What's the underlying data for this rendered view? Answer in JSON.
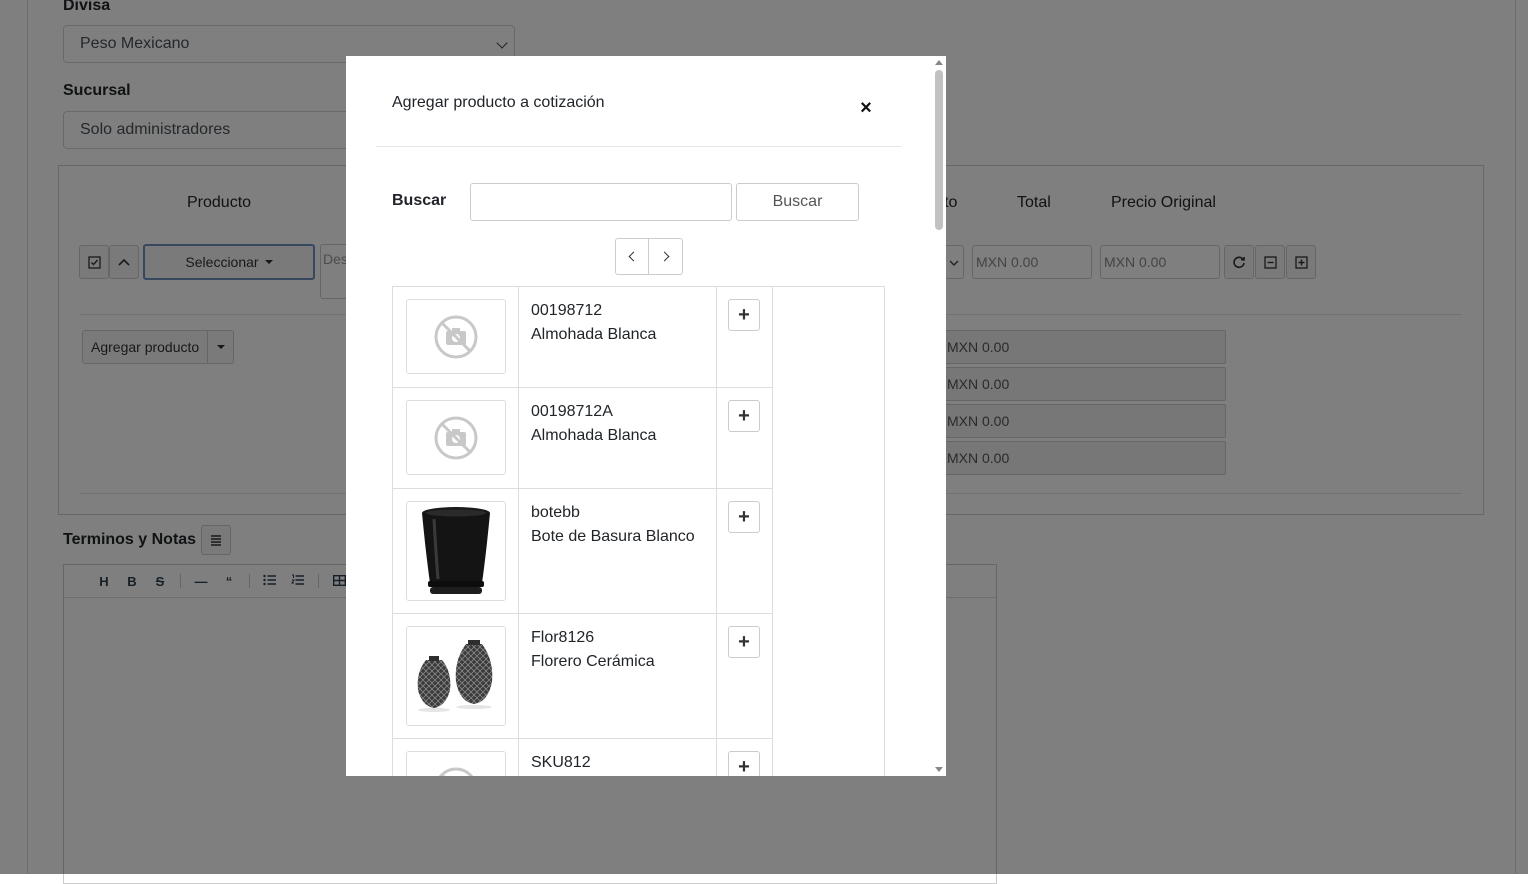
{
  "form": {
    "currency_label": "Divisa",
    "currency_value": "Peso Mexicano",
    "branch_label": "Sucursal",
    "branch_value": "Solo administradores"
  },
  "items": {
    "columns": {
      "product": "Producto",
      "discount_partial": "to",
      "total": "Total",
      "original_price": "Precio Original"
    },
    "select_label": "Seleccionar",
    "description_placeholder": "Des",
    "total_value": "MXN 0.00",
    "original_price_value": "MXN 0.00",
    "add_product_label": "Agregar producto",
    "totals": [
      "MXN 0.00",
      "MXN 0.00",
      "MXN 0.00",
      "MXN 0.00"
    ]
  },
  "notes": {
    "label": "Terminos y Notas",
    "toolbar": [
      "H",
      "B",
      "S",
      "—",
      "“",
      "list-ul",
      "list-ol",
      "table"
    ]
  },
  "modal": {
    "title": "Agregar producto a cotización",
    "close": "×",
    "search_label": "Buscar",
    "search_value": "",
    "search_button": "Buscar",
    "products": [
      {
        "sku": "00198712",
        "name": "Almohada Blanca",
        "image": "no-image-icon"
      },
      {
        "sku": "00198712A",
        "name": "Almohada Blanca",
        "image": "no-image-icon"
      },
      {
        "sku": "botebb",
        "name": "Bote de Basura Blanco",
        "image": "trash-bin-photo"
      },
      {
        "sku": "Flor8126",
        "name": "Florero Cerámica",
        "image": "vases-photo"
      },
      {
        "sku": "SKU812",
        "name": "",
        "image": "no-image-icon"
      }
    ],
    "add_button": "+"
  }
}
